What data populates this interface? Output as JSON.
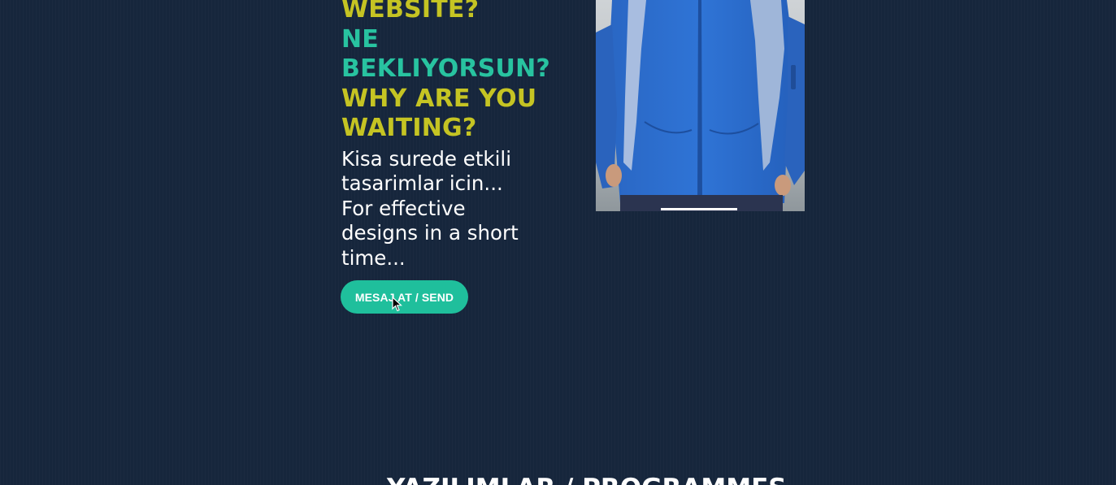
{
  "hero": {
    "headline": [
      {
        "text": "WEBSITE?",
        "color": "#c5c423"
      },
      {
        "text": "NE",
        "color": "#28c3a0"
      },
      {
        "text": "BEKLIYORSUN?",
        "color": "#28c3a0"
      },
      {
        "text": "WHY ARE YOU",
        "color": "#c5c423"
      },
      {
        "text": "WAITING?",
        "color": "#c5c423"
      }
    ],
    "subtext": [
      "Kisa surede etkili",
      "tasarimlar icin...",
      "For effective",
      "designs in a short",
      "time..."
    ],
    "cta_label": "MESAJ AT / SEND"
  },
  "photo": {
    "subject": "person-in-blue-jacket-photo"
  },
  "section": {
    "title": "YAZILIMLAR / PROGRAMMES"
  },
  "colors": {
    "background": "#16263c",
    "accent_teal": "#28c3a0",
    "accent_yellow": "#c5c423",
    "button": "#1fbf9c"
  }
}
